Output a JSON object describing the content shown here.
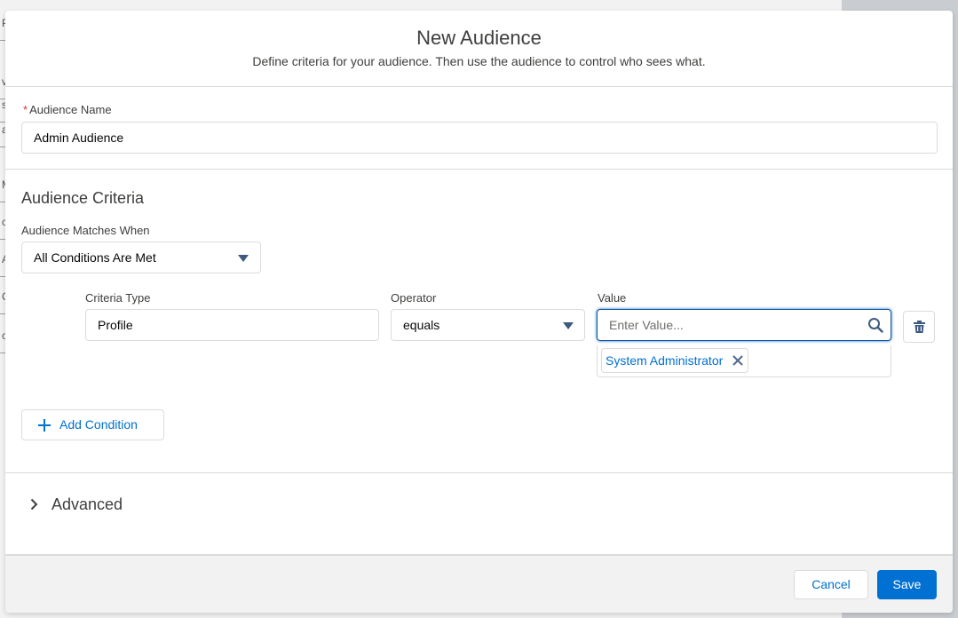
{
  "background": {
    "rows": [
      "P",
      "v",
      "s",
      "a",
      "M",
      "c",
      "A",
      "C",
      "c"
    ]
  },
  "modal": {
    "title": "New Audience",
    "subtitle": "Define criteria for your audience. Then use the audience to control who sees what."
  },
  "audience_name": {
    "required_marker": "*",
    "label": "Audience Name",
    "value": "Admin Audience"
  },
  "criteria": {
    "title": "Audience Criteria",
    "matches_label": "Audience Matches When",
    "matches_value": "All Conditions Are Met",
    "type_label": "Criteria Type",
    "type_value": "Profile",
    "operator_label": "Operator",
    "operator_value": "equals",
    "value_label": "Value",
    "value_placeholder": "Enter Value...",
    "selected_pill": "System Administrator",
    "add_condition": "Add Condition"
  },
  "advanced": {
    "label": "Advanced"
  },
  "footer": {
    "cancel": "Cancel",
    "save": "Save"
  },
  "colors": {
    "brand": "#0070d2",
    "required": "#c23934"
  }
}
